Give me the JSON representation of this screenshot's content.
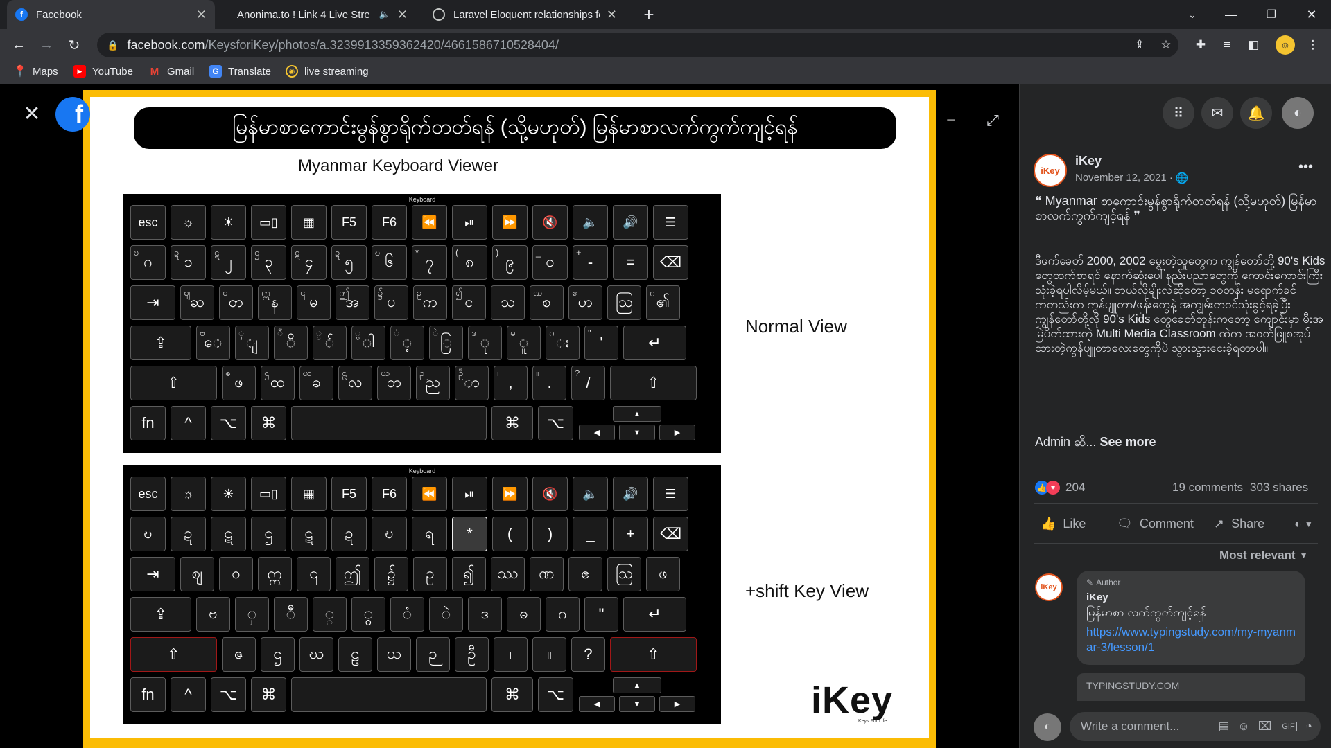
{
  "tabs": [
    {
      "title": "Facebook",
      "active": true
    },
    {
      "title": "Anonima.to ! Link 4 Live Stre",
      "active": false
    },
    {
      "title": "Laravel Eloquent relationships fo",
      "active": false
    }
  ],
  "address": {
    "host": "facebook.com",
    "path": "/KeysforiKey/photos/a.3239913359362420/4661586710528404/"
  },
  "bookmarks": [
    {
      "label": "Maps",
      "icon": "maps-icon"
    },
    {
      "label": "YouTube",
      "icon": "youtube-icon"
    },
    {
      "label": "Gmail",
      "icon": "gmail-icon"
    },
    {
      "label": "Translate",
      "icon": "translate-icon"
    },
    {
      "label": "live streaming",
      "icon": "live-streaming-icon"
    }
  ],
  "photo": {
    "banner": "မြန်မာစာကောင်းမွန်စွာရိုက်တတ်ရန် (သို့မဟုတ်) မြန်မာစာလက်ကွက်ကျင့်ရန်",
    "title": "Myanmar Keyboard Viewer",
    "keyboard_bar": "Keyboard",
    "normal_label": "Normal View",
    "shift_label": "+shift Key View",
    "logo": "iKey",
    "logo_sub": "Keys For Life",
    "normal_rows": [
      [
        "esc",
        "☼",
        "☀",
        "▭▯",
        "▦",
        "F5",
        "F6",
        "⏪",
        "⏯",
        "⏩",
        "🔇",
        "🔈",
        "🔊",
        "☰"
      ],
      [
        "ဂ",
        "၁",
        "၂",
        "၃",
        "၄",
        "၅",
        "၆",
        "၇",
        "၈",
        "၉",
        "၀",
        "-",
        "=",
        "⌫"
      ],
      [
        "⇥",
        "ဆ",
        "တ",
        "န",
        "မ",
        "အ",
        "ပ",
        "က",
        "င",
        "သ",
        "စ",
        "ဟ",
        "ဩ",
        "၏"
      ],
      [
        "⇪",
        "ေ",
        "ျ",
        "ိ",
        "်",
        "ါ",
        "့",
        "ြ",
        "ု",
        "ူ",
        "း",
        "'",
        "↵"
      ],
      [
        "⇧",
        "ဖ",
        "ထ",
        "ခ",
        "လ",
        "ဘ",
        "ည",
        "ာ",
        ",",
        ".",
        "/",
        "⇧"
      ]
    ],
    "normal_sups": [
      [],
      [
        "ဎ",
        "ဍ",
        "ဋ",
        "ဌ",
        "ဋ",
        "ဍ",
        "ဎ",
        "*",
        "(",
        ")",
        "_",
        "+",
        ""
      ],
      [
        "",
        "ဈ",
        "ဝ",
        "ဣ",
        "၎",
        "ဤ",
        "၌",
        "ဥ",
        "၍",
        "",
        "ဏ",
        "ဧ",
        "",
        "ဂ"
      ],
      [
        "",
        "ဗ",
        "ှ",
        "ီ",
        "္",
        "ွ",
        "ံ",
        "ဲ",
        "ဒ",
        "ဓ",
        "ဂ",
        "\"",
        ""
      ],
      [
        "",
        "ဇ",
        "ဌ",
        "ဃ",
        "ဠ",
        "ယ",
        "ဉ",
        "ဦ",
        "၊",
        "။",
        "?",
        "",
        ""
      ]
    ],
    "shift_rows": [
      [
        "esc",
        "☼",
        "☀",
        "▭▯",
        "▦",
        "F5",
        "F6",
        "⏪",
        "⏯",
        "⏩",
        "🔇",
        "🔈",
        "🔊",
        "☰"
      ],
      [
        "ဎ",
        "ဍ",
        "ဋ",
        "ဌ",
        "ဋ",
        "ဍ",
        "ဎ",
        "ရ",
        "*",
        "(",
        ")",
        "_",
        "+",
        "⌫"
      ],
      [
        "⇥",
        "ဈ",
        "ဝ",
        "ဣ",
        "၎",
        "ဤ",
        "၌",
        "ဥ",
        "၍",
        "ဿ",
        "ဏ",
        "ဧ",
        "ဩ",
        "ဖ"
      ],
      [
        "⇪",
        "ဗ",
        "ှ",
        "ီ",
        "္",
        "ွ",
        "ံ",
        "ဲ",
        "ဒ",
        "ဓ",
        "ဂ",
        "\"",
        "↵"
      ],
      [
        "⇧",
        "ဇ",
        "ဌ",
        "ဃ",
        "ဠ",
        "ယ",
        "ဉ",
        "ဦ",
        "၊",
        "။",
        "?",
        "⇧"
      ]
    ],
    "bottom_keys": [
      "fn",
      "^",
      "⌥",
      "⌘",
      "⌘",
      "⌥"
    ],
    "arrow_keys": [
      "▲",
      "◀",
      "▼",
      "▶"
    ]
  },
  "post": {
    "author": "iKey",
    "date": "November 12, 2021 ·",
    "caption": "❝ Myanmar စာကောင်းမွန်စွာရိုက်တတ်ရန် (သို့မဟုတ်) မြန်မာစာလက်ကွက်ကျင့်ရန် ❞",
    "body": "ဒီဖက်ခေတ် 2000, 2002 မွေးတဲ့သူတွေက ကျွန်တော်တို့ 90's Kids တွေထက်စာရင် နောက်ဆုံးပေါ်နည်းပညာတွေကို ကောင်းကောင်းကြီးသုံးခဲ့ရပါလိမ့်မယ်။ ဘယ်လိုမျိုးလဲဆိုတော့ ၁၀တန်း မရောက်ခင်ကတည်းက ကွန်ပျူတာ/ဖုန်းတွေနဲ့ အကျွမ်းတဝင်သုံးခွင့်ရခဲ့ပြီး ကျွန်တော်တို့လို 90's Kids တွေခေတ်တုန်းကတော့ ကျောင်းမှာ မီးအမြဲပိတ်ထားတဲ့ Multi Media Classroom ထဲက အဝတ်ဖြူစအုပ်ထားတဲ့ကွန်ပျူတာလေးတွေကိုပဲ သွားသွားငေးခဲ့ရတာပါ။",
    "admin": "Admin ဆိ...",
    "see_more": "See more",
    "reactions": "204",
    "comments": "19 comments",
    "shares": "303 shares",
    "like": "Like",
    "comment": "Comment",
    "share": "Share",
    "sort": "Most relevant",
    "comment_badge": "Author",
    "comment_author": "iKey",
    "comment_text": "မြန်မာစာ လက်ကွက်ကျင့်ရန်",
    "comment_link": "https://www.typingstudy.com/my-myanmar-3/lesson/1",
    "card_domain": "TYPINGSTUDY.COM",
    "write_placeholder": "Write a comment..."
  },
  "colors": {
    "fb_blue": "#1877f2",
    "frame_yellow": "#fbbc05",
    "link": "#4599ff"
  }
}
